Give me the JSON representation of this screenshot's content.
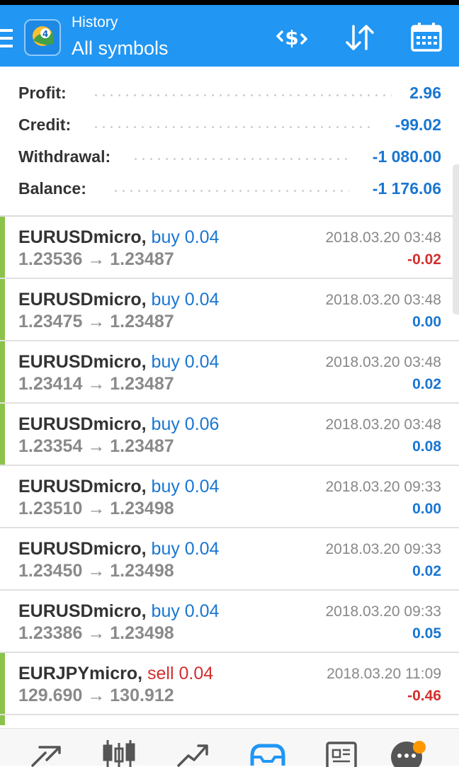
{
  "header": {
    "subtitle": "History",
    "title": "All symbols",
    "icons": [
      "menu-icon",
      "app-logo",
      "currency-exchange-icon",
      "sort-icon",
      "calendar-icon"
    ]
  },
  "summary": [
    {
      "label": "Profit:",
      "value": "2.96"
    },
    {
      "label": "Credit:",
      "value": "-99.02"
    },
    {
      "label": "Withdrawal:",
      "value": "-1 080.00"
    },
    {
      "label": "Balance:",
      "value": "-1 176.06"
    }
  ],
  "deals": [
    {
      "symbol": "EURUSDmicro,",
      "type": "buy 0.04",
      "prices": "1.23536 → 1.23487",
      "time": "2018.03.20 03:48",
      "profit": "-0.02",
      "sign": "neg"
    },
    {
      "symbol": "EURUSDmicro,",
      "type": "buy 0.04",
      "prices": "1.23475 → 1.23487",
      "time": "2018.03.20 03:48",
      "profit": "0.00",
      "sign": "pos"
    },
    {
      "symbol": "EURUSDmicro,",
      "type": "buy 0.04",
      "prices": "1.23414 → 1.23487",
      "time": "2018.03.20 03:48",
      "profit": "0.02",
      "sign": "pos"
    },
    {
      "symbol": "EURUSDmicro,",
      "type": "buy 0.06",
      "prices": "1.23354 → 1.23487",
      "time": "2018.03.20 03:48",
      "profit": "0.08",
      "sign": "pos"
    },
    {
      "symbol": "EURUSDmicro,",
      "type": "buy 0.04",
      "prices": "1.23510 → 1.23498",
      "time": "2018.03.20 09:33",
      "profit": "0.00",
      "sign": "pos"
    },
    {
      "symbol": "EURUSDmicro,",
      "type": "buy 0.04",
      "prices": "1.23450 → 1.23498",
      "time": "2018.03.20 09:33",
      "profit": "0.02",
      "sign": "pos"
    },
    {
      "symbol": "EURUSDmicro,",
      "type": "buy 0.04",
      "prices": "1.23386 → 1.23498",
      "time": "2018.03.20 09:33",
      "profit": "0.05",
      "sign": "pos"
    },
    {
      "symbol": "EURJPYmicro,",
      "type": "sell 0.04",
      "prices": "129.690 → 130.912",
      "time": "2018.03.20 11:09",
      "profit": "-0.46",
      "sign": "neg"
    }
  ],
  "bottom_nav": [
    "quotes-icon",
    "chart-icon",
    "trade-icon",
    "history-icon",
    "news-icon",
    "messages-icon"
  ],
  "colors": {
    "accent": "#2196f3",
    "positive": "#1976d2",
    "negative": "#d32f2f",
    "deal_bar": "#8bc34a"
  }
}
